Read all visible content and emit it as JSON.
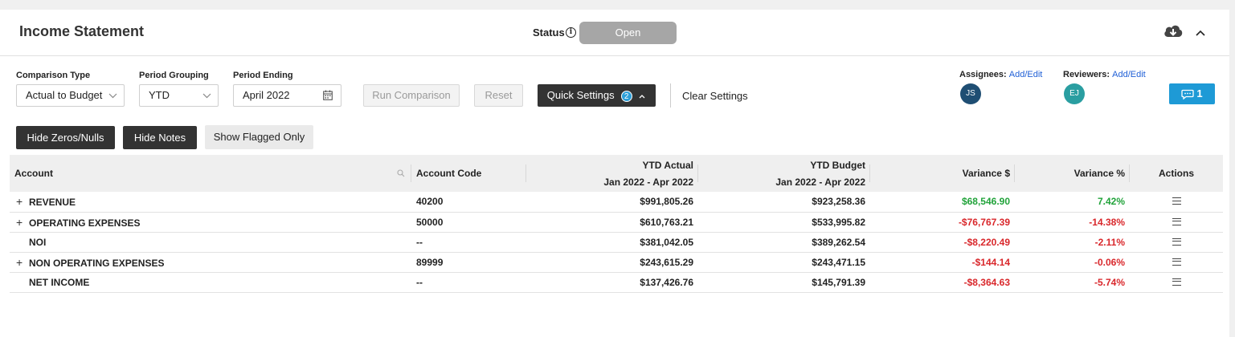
{
  "header": {
    "title": "Income Statement",
    "status_label": "Status",
    "status_value": "Open"
  },
  "filters": {
    "comparison_type": {
      "label": "Comparison Type",
      "value": "Actual to Budget"
    },
    "period_grouping": {
      "label": "Period Grouping",
      "value": "YTD"
    },
    "period_ending": {
      "label": "Period Ending",
      "value": "April 2022"
    },
    "run_comparison": "Run Comparison",
    "reset": "Reset",
    "quick_settings": "Quick Settings",
    "quick_settings_count": "2",
    "clear_settings": "Clear Settings"
  },
  "assignees": {
    "label": "Assignees:",
    "link": "Add/Edit",
    "initials": "JS",
    "color": "#1f4e73"
  },
  "reviewers": {
    "label": "Reviewers:",
    "link": "Add/Edit",
    "initials": "EJ",
    "color": "#2a9ea1"
  },
  "comments": {
    "count": "1"
  },
  "toggles": {
    "hide_zeros": "Hide Zeros/Nulls",
    "hide_notes": "Hide Notes",
    "show_flagged": "Show Flagged Only"
  },
  "table": {
    "columns": {
      "account": "Account",
      "account_code": "Account Code",
      "ytd_actual": "YTD Actual",
      "ytd_actual_period": "Jan 2022 - Apr 2022",
      "ytd_budget": "YTD Budget",
      "ytd_budget_period": "Jan 2022 - Apr 2022",
      "variance_dollar": "Variance $",
      "variance_pct": "Variance %",
      "actions": "Actions"
    },
    "rows": [
      {
        "expandable": true,
        "account": "REVENUE",
        "code": "40200",
        "actual": "$991,805.26",
        "budget": "$923,258.36",
        "var_dollar": "$68,546.90",
        "var_pct": "7.42%",
        "sign": "pos"
      },
      {
        "expandable": true,
        "account": "OPERATING EXPENSES",
        "code": "50000",
        "actual": "$610,763.21",
        "budget": "$533,995.82",
        "var_dollar": "-$76,767.39",
        "var_pct": "-14.38%",
        "sign": "neg"
      },
      {
        "expandable": false,
        "account": "NOI",
        "code": "--",
        "actual": "$381,042.05",
        "budget": "$389,262.54",
        "var_dollar": "-$8,220.49",
        "var_pct": "-2.11%",
        "sign": "neg"
      },
      {
        "expandable": true,
        "account": "NON OPERATING EXPENSES",
        "code": "89999",
        "actual": "$243,615.29",
        "budget": "$243,471.15",
        "var_dollar": "-$144.14",
        "var_pct": "-0.06%",
        "sign": "neg"
      },
      {
        "expandable": false,
        "account": "NET INCOME",
        "code": "--",
        "actual": "$137,426.76",
        "budget": "$145,791.39",
        "var_dollar": "-$8,364.63",
        "var_pct": "-5.74%",
        "sign": "neg"
      }
    ]
  }
}
